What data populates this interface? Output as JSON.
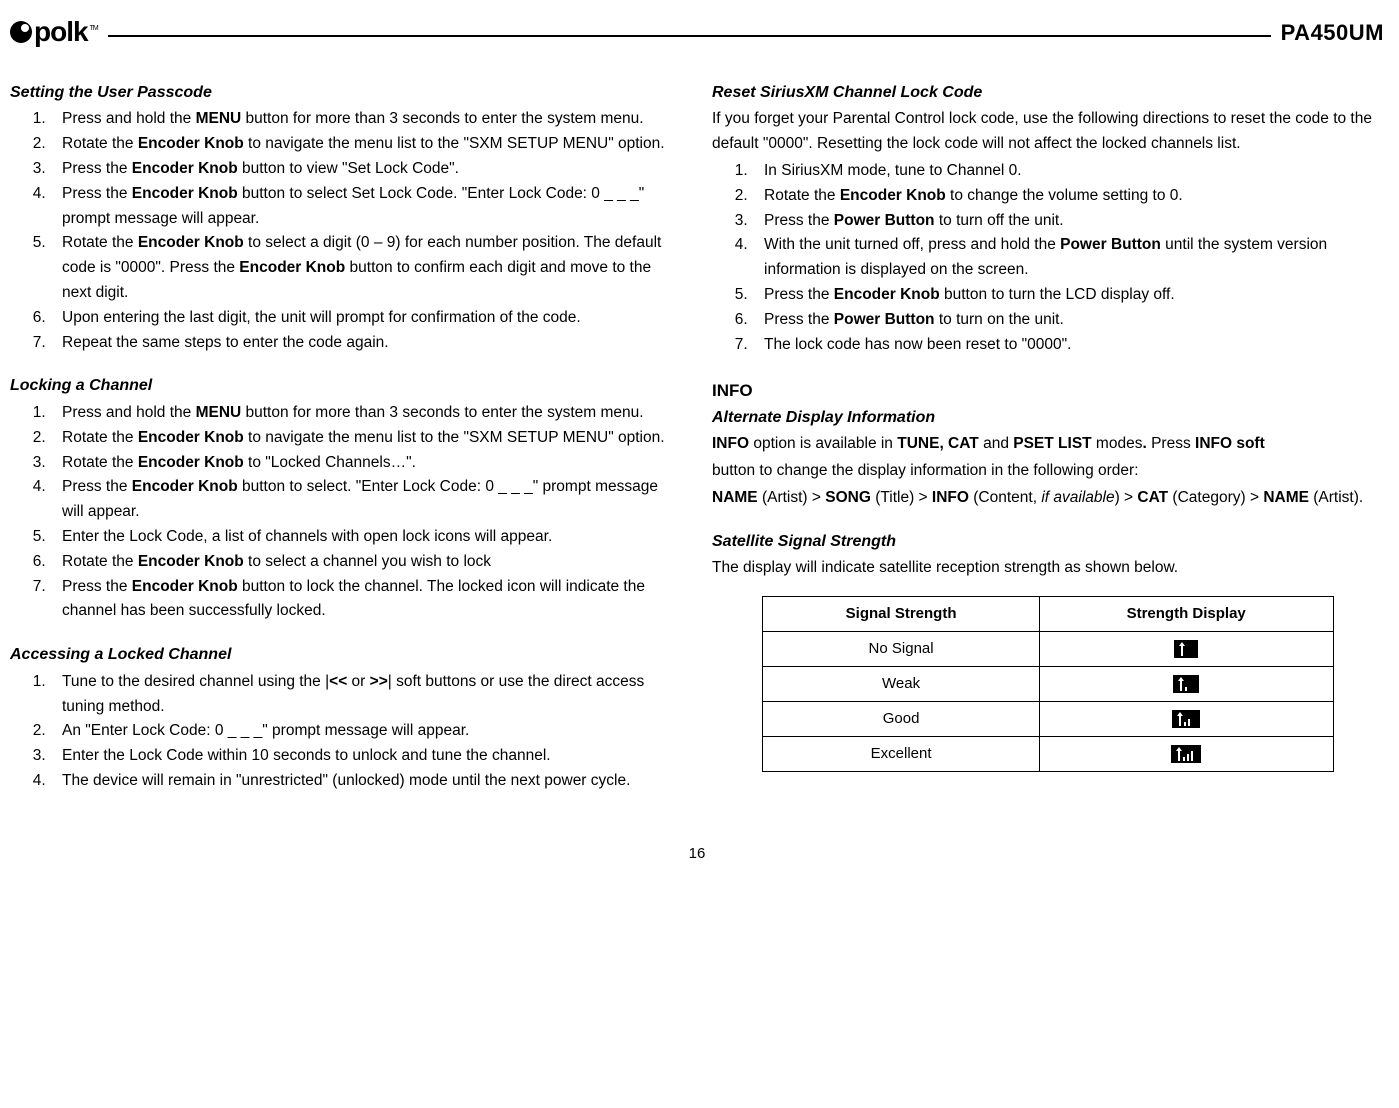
{
  "header": {
    "brand": "polk",
    "model": "PA450UM"
  },
  "left": {
    "passcode": {
      "title": "Setting the User Passcode",
      "items": [
        {
          "pre": "Press and hold the ",
          "b1": "MENU",
          "post": " button for more than 3 seconds to enter the system menu."
        },
        {
          "pre": "Rotate the ",
          "b1": "Encoder Knob",
          "post": " to navigate the menu list to the \"SXM SETUP MENU\" option."
        },
        {
          "pre": "Press the ",
          "b1": "Encoder Knob",
          "post": " button to view \"Set Lock Code\"."
        },
        {
          "pre": "Press the ",
          "b1": "Encoder Knob",
          "post": " button to select Set Lock Code. \"Enter Lock Code: 0 _ _ _\" prompt message will appear."
        },
        {
          "pre": "Rotate the ",
          "b1": "Encoder Knob",
          "mid": " to select a digit (0 – 9) for each number position. The default code is \"0000\".    Press the ",
          "b2": "Encoder Knob",
          "post": " button to confirm each digit and move to the next digit."
        },
        {
          "plain": "Upon entering the last digit, the unit will prompt for confirmation of the code."
        },
        {
          "plain": "Repeat the same steps to enter the code again."
        }
      ]
    },
    "locking": {
      "title": "Locking a Channel",
      "items": [
        {
          "pre": "Press and hold the ",
          "b1": "MENU",
          "post": " button for more than 3 seconds to enter the system menu."
        },
        {
          "pre": "Rotate the ",
          "b1": "Encoder Knob",
          "post": " to navigate the menu list to the \"SXM SETUP MENU\" option."
        },
        {
          "pre": "Rotate the ",
          "b1": "Encoder Knob",
          "post": " to \"Locked Channels…\"."
        },
        {
          "pre": "Press the ",
          "b1": "Encoder Knob",
          "post": " button to select. \"Enter Lock Code: 0 _ _ _\" prompt message will appear."
        },
        {
          "plain": "Enter the Lock Code, a list of channels with open lock icons will appear."
        },
        {
          "pre": "Rotate the ",
          "b1": "Encoder Knob",
          "post": " to select a channel you wish to lock"
        },
        {
          "pre": "Press the ",
          "b1": "Encoder Knob",
          "post": " button to lock the channel. The locked icon will indicate the channel has been successfully locked."
        }
      ]
    },
    "access": {
      "title": "Accessing a Locked Channel",
      "items": [
        {
          "pre": "Tune to the desired channel using the |",
          "b1": "<<",
          "mid": " or ",
          "b2": ">>",
          "post": "| soft buttons or use the direct access tuning method."
        },
        {
          "plain": "An \"Enter Lock Code: 0 _ _ _\" prompt message will appear."
        },
        {
          "plain": "Enter the Lock Code within 10 seconds to unlock and tune the channel."
        },
        {
          "plain": "The device will remain in \"unrestricted\" (unlocked) mode until the next power cycle."
        }
      ]
    }
  },
  "right": {
    "reset": {
      "title": "Reset SiriusXM Channel Lock Code",
      "intro": "If you forget your Parental Control lock code, use the following directions to reset the code to the default \"0000\". Resetting the lock code will not affect the locked channels list.",
      "items": [
        {
          "plain": "In SiriusXM mode, tune to Channel 0."
        },
        {
          "pre": "Rotate the ",
          "b1": "Encoder Knob",
          "post": " to change the volume setting to 0."
        },
        {
          "pre": "Press the ",
          "b1": "Power Button",
          "post": " to turn off the unit."
        },
        {
          "pre": "With the unit turned off, press and hold the ",
          "b1": "Power Button",
          "post": " until the system version information is displayed on the screen."
        },
        {
          "pre": "Press the ",
          "b1": "Encoder Knob",
          "post": " button to turn the LCD display off."
        },
        {
          "pre": "Press the ",
          "b1": "Power Button",
          "post": " to turn on the unit."
        },
        {
          "plain": "The lock code has now been reset to \"0000\"."
        }
      ]
    },
    "info": {
      "heading": "INFO",
      "alt_title": "Alternate Display Information",
      "t": {
        "b_info": "INFO",
        "t1": " option is available in ",
        "b_tune": "TUNE, CAT",
        "t2": " and ",
        "b_pset": "PSET LIST",
        "t3": " modes",
        "b_dot": ".",
        "t4": " Press ",
        "b_soft": "INFO soft",
        "p2": "button to change the display information in the following order:",
        "b_name": "NAME",
        "t5": " (Artist) > ",
        "b_song": "SONG",
        "t6": " (Title) > ",
        "b_info2": "INFO",
        "t7": " (Content, ",
        "i_avail": "if available",
        "t8": ") > ",
        "b_cat": "CAT",
        "t9": " (Category) > ",
        "b_name2": "NAME",
        "t10": " (Artist)."
      },
      "sat_title": "Satellite Signal Strength",
      "sat_intro": "The display will indicate satellite reception strength as shown below.",
      "table": {
        "h1": "Signal Strength",
        "h2": "Strength Display",
        "rows": [
          "No Signal",
          "Weak",
          "Good",
          "Excellent"
        ]
      }
    }
  },
  "page": "16"
}
